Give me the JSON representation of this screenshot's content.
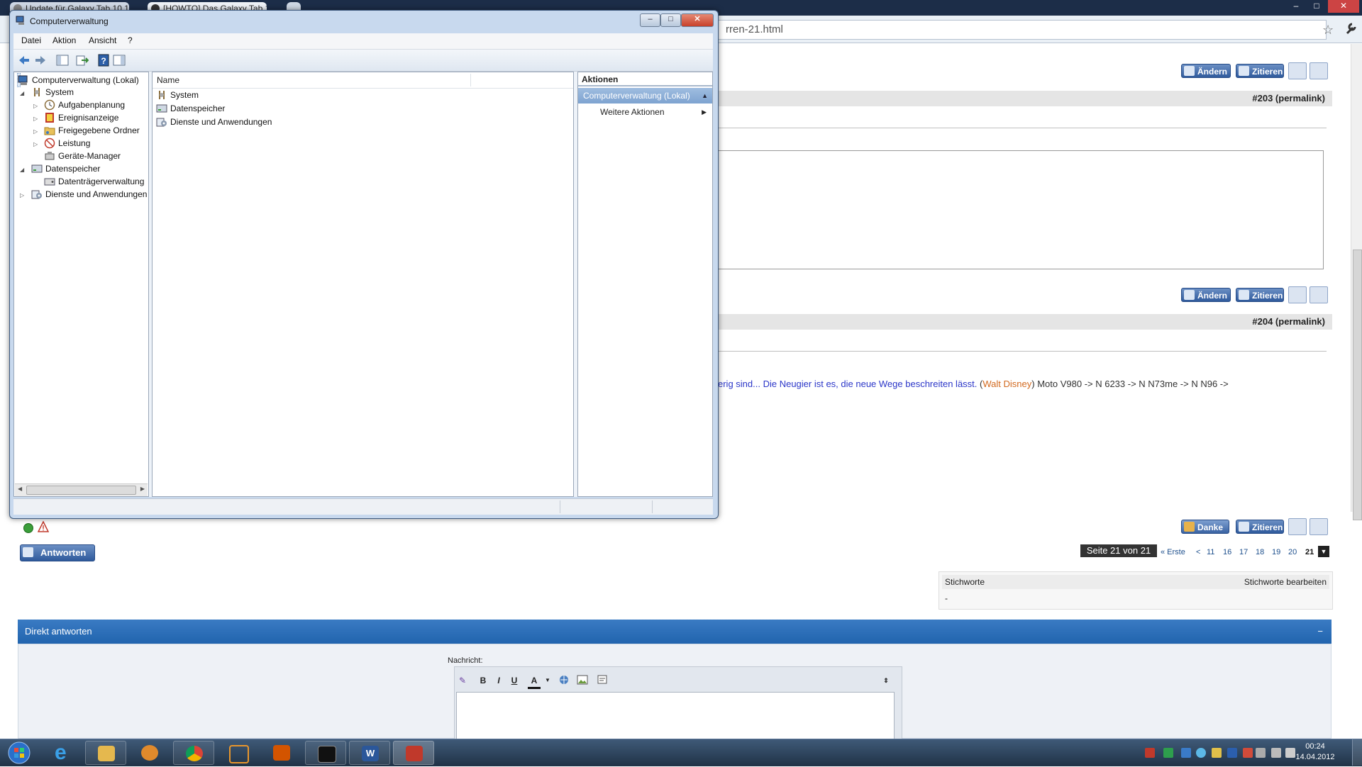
{
  "browser": {
    "tabs": [
      {
        "label": "Update für Galaxy Tab 10.1..."
      },
      {
        "label": "[HOWTO] Das Galaxy Tab 1..."
      }
    ],
    "url_fragment": "rren-21.html",
    "window_controls": {
      "minimize": "–",
      "maximize": "□",
      "close": "✕"
    }
  },
  "forum": {
    "buttons": {
      "andern": "Ändern",
      "zitieren": "Zitieren",
      "danke": "Danke",
      "antworten": "Antworten"
    },
    "posts": [
      {
        "number": "#203",
        "permalink": "(permalink)"
      },
      {
        "number": "#204",
        "permalink": "(permalink)"
      }
    ],
    "signature": {
      "quote_text": "erig sind... Die Neugier ist es, die neue Wege beschreiten lässt.",
      "author": "Walt Disney",
      "phones": "Moto V980 -> N 6233 -> N N73me -> N N96 ->"
    },
    "pagination": {
      "label": "Seite 21 von 21",
      "first": "« Erste",
      "prev": "<",
      "pages": [
        "11",
        "16",
        "17",
        "18",
        "19",
        "20"
      ],
      "current": "21"
    },
    "tags": {
      "title": "Stichworte",
      "edit": "Stichworte bearbeiten",
      "value": "-"
    },
    "reply": {
      "title": "Direkt antworten",
      "collapse": "−",
      "message_label": "Nachricht:",
      "toolbar": [
        "B",
        "I",
        "U",
        "A"
      ]
    }
  },
  "mmc": {
    "title": "Computerverwaltung",
    "menu": [
      "Datei",
      "Aktion",
      "Ansicht",
      "?"
    ],
    "tree": {
      "root": "Computerverwaltung (Lokal)",
      "items": [
        {
          "label": "System",
          "level": 1,
          "expander": "▲"
        },
        {
          "label": "Aufgabenplanung",
          "level": 2,
          "expander": "▷"
        },
        {
          "label": "Ereignisanzeige",
          "level": 2,
          "expander": "▷"
        },
        {
          "label": "Freigegebene Ordner",
          "level": 2,
          "expander": "▷"
        },
        {
          "label": "Leistung",
          "level": 2,
          "expander": "▷"
        },
        {
          "label": "Geräte-Manager",
          "level": 2,
          "expander": ""
        },
        {
          "label": "Datenspeicher",
          "level": 1,
          "expander": "▲"
        },
        {
          "label": "Datenträgerverwaltung",
          "level": 2,
          "expander": ""
        },
        {
          "label": "Dienste und Anwendungen",
          "level": 1,
          "expander": "▷"
        }
      ]
    },
    "list": {
      "column_header": "Name",
      "items": [
        "System",
        "Datenspeicher",
        "Dienste und Anwendungen"
      ]
    },
    "actions": {
      "header": "Aktionen",
      "section": "Computerverwaltung (Lokal)",
      "items": [
        "Weitere Aktionen"
      ]
    }
  },
  "taskbar": {
    "time": "00:24",
    "date": "14.04.2012"
  }
}
